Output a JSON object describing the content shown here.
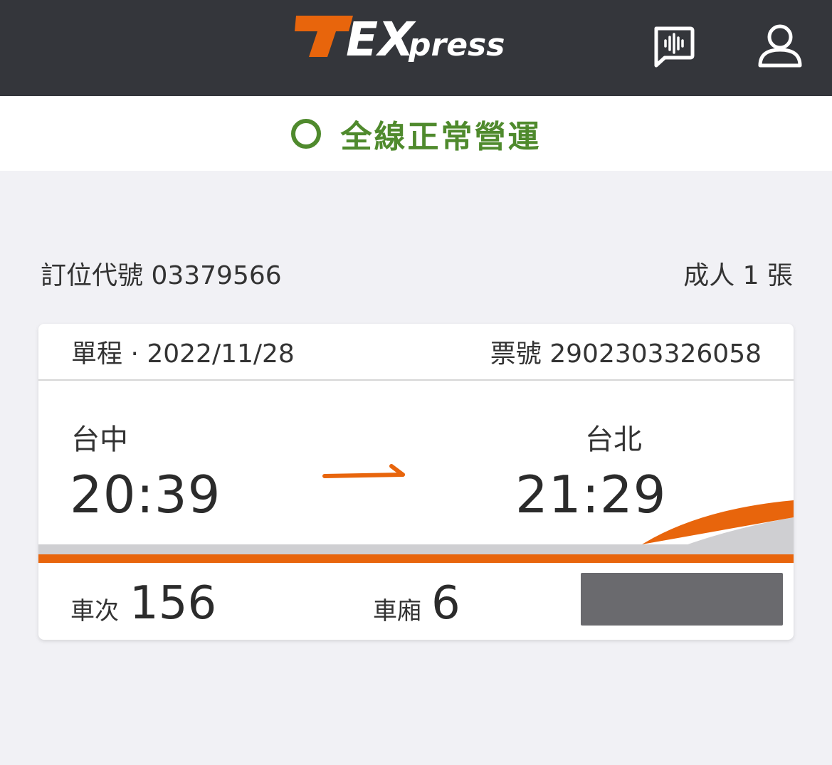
{
  "header": {
    "logo_alt": "TEXpress",
    "voice_icon": "voice-message-icon",
    "user_icon": "user-profile-icon"
  },
  "status": {
    "text": "全線正常營運",
    "color": "#4f8a2d"
  },
  "booking": {
    "code_label": "訂位代號 03379566",
    "passengers": "成人 1 張"
  },
  "ticket": {
    "trip": "單程 · 2022/11/28",
    "ticket_no": "票號 2902303326058",
    "from_station": "台中",
    "from_time": "20:39",
    "to_station": "台北",
    "to_time": "21:29",
    "train_label": "車次",
    "train_no": "156",
    "car_label": "車廂",
    "car_no": "6",
    "accent_color": "#e8650c"
  }
}
